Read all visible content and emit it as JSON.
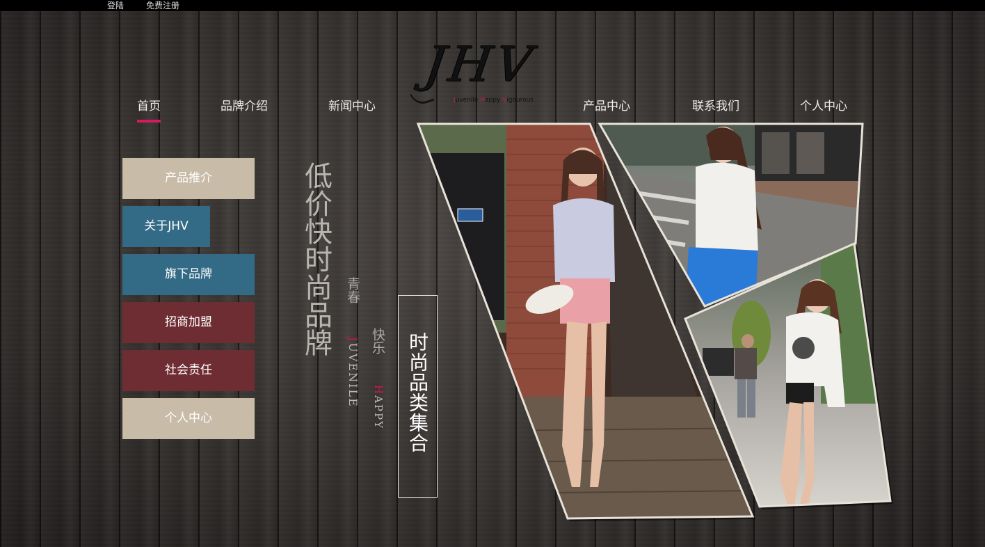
{
  "topbar": {
    "login": "登陆",
    "register": "免费注册"
  },
  "logo": {
    "mark": "JHV",
    "tagline_j": "J",
    "tagline_1": "uvenile ",
    "tagline_h": "H",
    "tagline_2": "appy ",
    "tagline_v": "V",
    "tagline_3": "igourous"
  },
  "nav": {
    "home": "首页",
    "brand": "品牌介绍",
    "news": "新闻中心",
    "products": "产品中心",
    "contact": "联系我们",
    "personal": "个人中心"
  },
  "sidebar": {
    "items": [
      {
        "label": "产品推介"
      },
      {
        "label": "关于JHV"
      },
      {
        "label": "旗下品牌"
      },
      {
        "label": "招商加盟"
      },
      {
        "label": "社会责任"
      },
      {
        "label": "个人中心"
      }
    ]
  },
  "slogans": {
    "main": "低价快时尚品牌",
    "youth": "青春",
    "juvenile_first": "J",
    "juvenile_rest": "UVENILE",
    "happy_cn": "快乐",
    "happy_first": "H",
    "happy_rest": "APPY",
    "boxed": "时尚品类集合"
  },
  "colors": {
    "accent": "#d51a5d",
    "beige": "#c8bba8",
    "teal": "#336a86",
    "maroon": "#6e2d32"
  }
}
